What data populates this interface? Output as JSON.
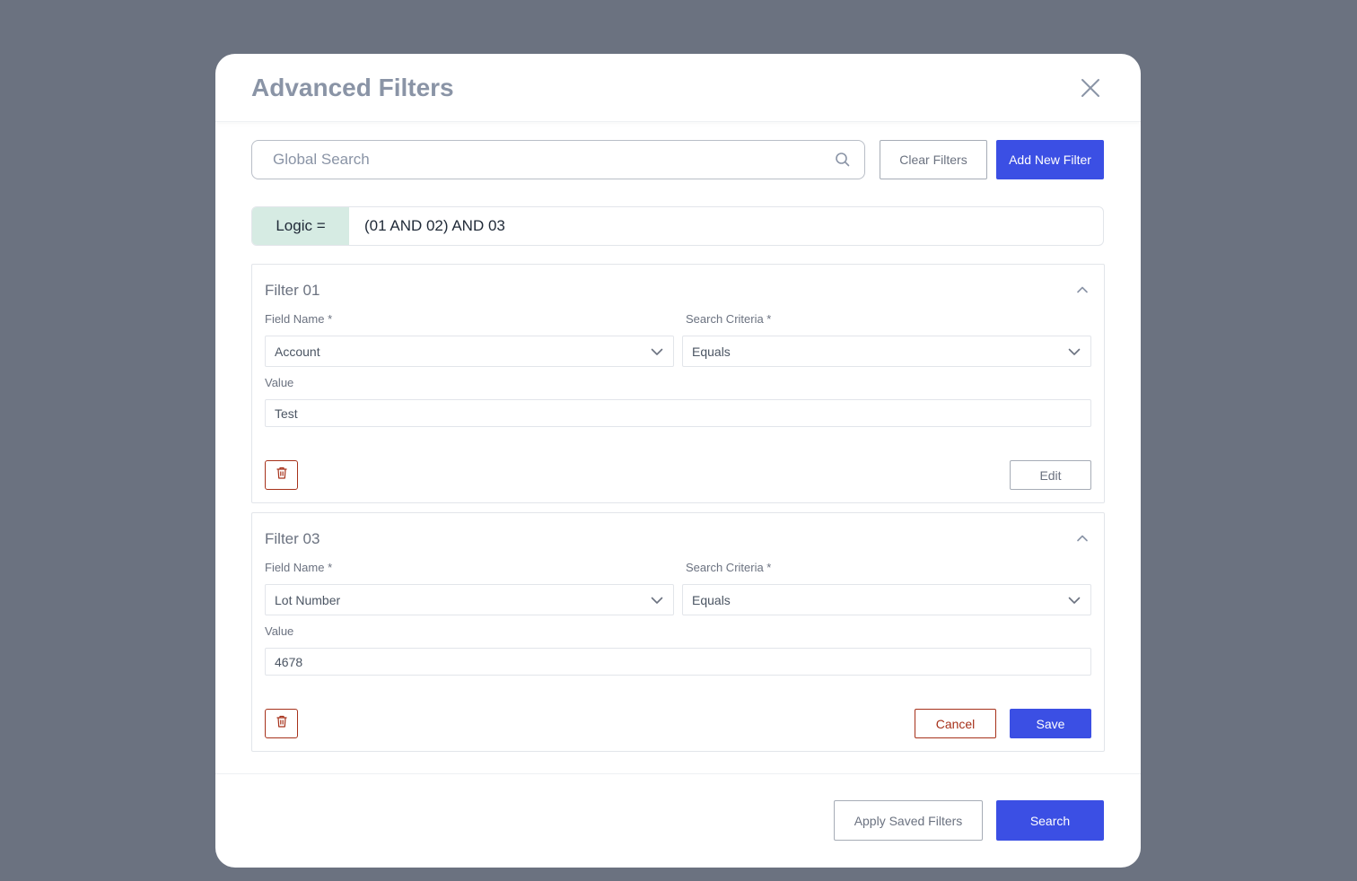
{
  "modal": {
    "title": "Advanced Filters"
  },
  "toolbar": {
    "search_placeholder": "Global Search",
    "clear_filters_label": "Clear Filters",
    "add_filter_label": "Add New Filter"
  },
  "logic": {
    "label": "Logic =",
    "expression": "(01 AND 02) AND 03"
  },
  "filters": [
    {
      "title": "Filter 01",
      "field_name_label": "Field Name *",
      "field_name_value": "Account",
      "criteria_label": "Search Criteria *",
      "criteria_value": "Equals",
      "value_label": "Value",
      "value": "Test",
      "edit_label": "Edit"
    },
    {
      "title": "Filter 03",
      "field_name_label": "Field Name *",
      "field_name_value": "Lot Number",
      "criteria_label": "Search Criteria *",
      "criteria_value": "Equals",
      "value_label": "Value",
      "value": "4678",
      "cancel_label": "Cancel",
      "save_label": "Save"
    }
  ],
  "footer": {
    "apply_saved_label": "Apply Saved Filters",
    "search_label": "Search"
  },
  "colors": {
    "backdrop": "#6b7280",
    "primary": "#3b4fe4",
    "danger": "#a6311a",
    "logic_bg": "#d6ebe3"
  },
  "icons": [
    "close-icon",
    "search-icon",
    "chevron-up-icon",
    "chevron-down-icon",
    "trash-icon"
  ]
}
